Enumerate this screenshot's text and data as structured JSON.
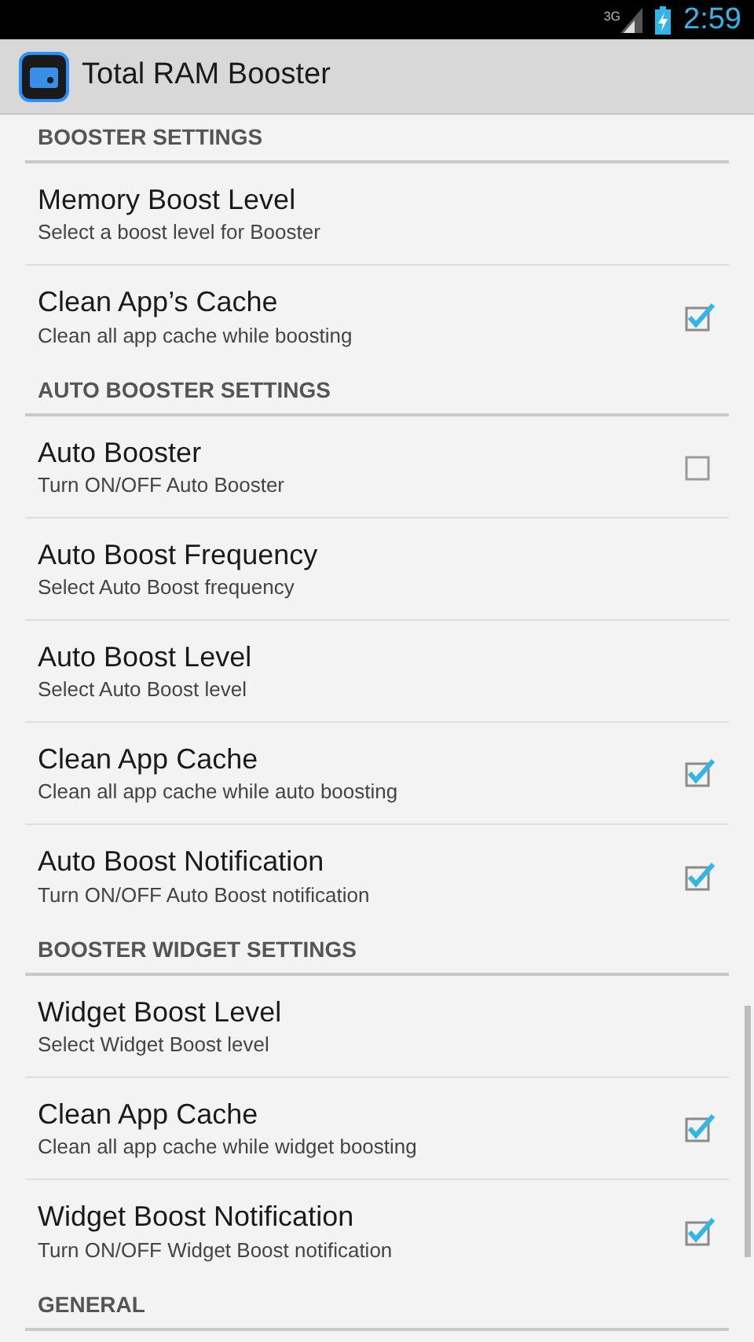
{
  "status_bar": {
    "network": "3G",
    "time": "2:59"
  },
  "app_bar": {
    "title": "Total RAM Booster"
  },
  "sections": [
    {
      "header": "BOOSTER SETTINGS",
      "items": [
        {
          "kind": "text",
          "title": "Memory Boost Level",
          "summary": "Select a boost level for Booster"
        },
        {
          "kind": "checkbox",
          "title": "Clean App’s Cache",
          "summary": "Clean all app cache while boosting",
          "checked": true
        }
      ]
    },
    {
      "header": "AUTO BOOSTER SETTINGS",
      "items": [
        {
          "kind": "checkbox",
          "title": "Auto Booster",
          "summary": "Turn ON/OFF Auto Booster",
          "checked": false
        },
        {
          "kind": "text",
          "title": "Auto Boost Frequency",
          "summary": "Select Auto Boost frequency"
        },
        {
          "kind": "text",
          "title": "Auto Boost Level",
          "summary": "Select Auto Boost level"
        },
        {
          "kind": "checkbox",
          "title": "Clean App Cache",
          "summary": "Clean all app cache while auto boosting",
          "checked": true
        },
        {
          "kind": "checkbox",
          "title": "Auto Boost Notification",
          "summary": "Turn ON/OFF Auto Boost notification",
          "checked": true
        }
      ]
    },
    {
      "header": "BOOSTER WIDGET SETTINGS",
      "items": [
        {
          "kind": "text",
          "title": "Widget Boost Level",
          "summary": "Select Widget Boost level"
        },
        {
          "kind": "checkbox",
          "title": "Clean App Cache",
          "summary": "Clean all app cache while widget boosting",
          "checked": true
        },
        {
          "kind": "checkbox",
          "title": "Widget Boost Notification",
          "summary": "Turn ON/OFF Widget Boost notification",
          "checked": true
        }
      ]
    },
    {
      "header": "GENERAL"
    }
  ]
}
